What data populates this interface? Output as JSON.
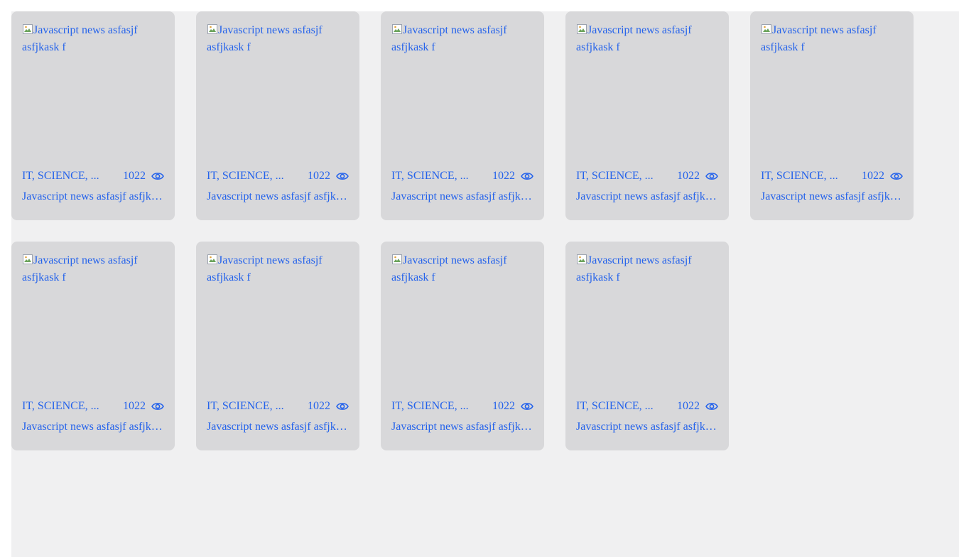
{
  "cards": [
    {
      "image_alt": "Javascript news asfasjf asfjkask f",
      "categories": "IT, SCIENCE, ...",
      "views": "1022",
      "title": "Javascript news asfasjf asfjkask f"
    },
    {
      "image_alt": "Javascript news asfasjf asfjkask f",
      "categories": "IT, SCIENCE, ...",
      "views": "1022",
      "title": "Javascript news asfasjf asfjkask f"
    },
    {
      "image_alt": "Javascript news asfasjf asfjkask f",
      "categories": "IT, SCIENCE, ...",
      "views": "1022",
      "title": "Javascript news asfasjf asfjkask f"
    },
    {
      "image_alt": "Javascript news asfasjf asfjkask f",
      "categories": "IT, SCIENCE, ...",
      "views": "1022",
      "title": "Javascript news asfasjf asfjkask f"
    },
    {
      "image_alt": "Javascript news asfasjf asfjkask f",
      "categories": "IT, SCIENCE, ...",
      "views": "1022",
      "title": "Javascript news asfasjf asfjkask f"
    },
    {
      "image_alt": "Javascript news asfasjf asfjkask f",
      "categories": "IT, SCIENCE, ...",
      "views": "1022",
      "title": "Javascript news asfasjf asfjkask f"
    },
    {
      "image_alt": "Javascript news asfasjf asfjkask f",
      "categories": "IT, SCIENCE, ...",
      "views": "1022",
      "title": "Javascript news asfasjf asfjkask f"
    },
    {
      "image_alt": "Javascript news asfasjf asfjkask f",
      "categories": "IT, SCIENCE, ...",
      "views": "1022",
      "title": "Javascript news asfasjf asfjkask f"
    },
    {
      "image_alt": "Javascript news asfasjf asfjkask f",
      "categories": "IT, SCIENCE, ...",
      "views": "1022",
      "title": "Javascript news asfasjf asfjkask f"
    }
  ],
  "colors": {
    "link": "#2563eb",
    "card_bg": "#d8d8da",
    "page_bg": "#f0f0f1"
  },
  "icons": {
    "views": "eye-icon",
    "broken_image": "broken-image-icon"
  }
}
